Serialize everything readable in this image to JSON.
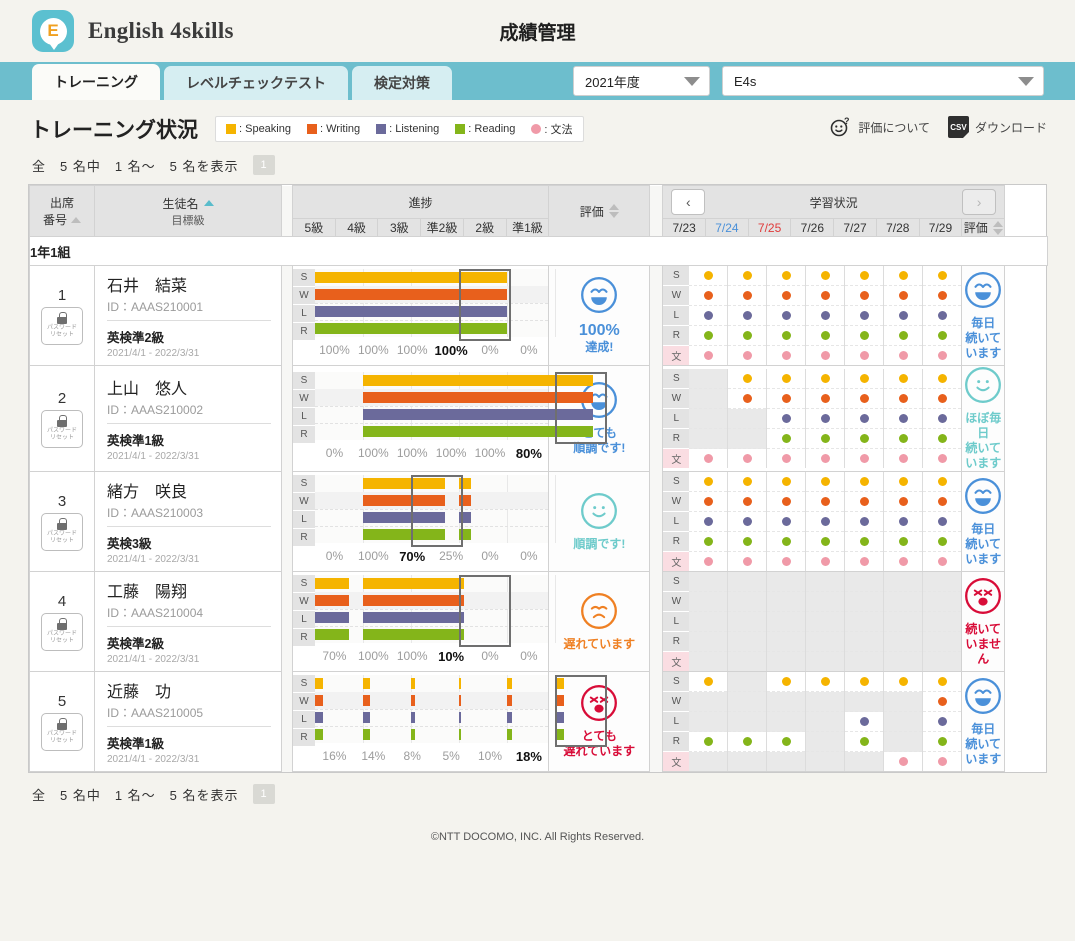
{
  "header": {
    "brand": "English 4skills",
    "logo_letter": "E",
    "page_title": "成績管理"
  },
  "tabs": [
    {
      "label": "トレーニング",
      "active": true
    },
    {
      "label": "レベルチェックテスト",
      "active": false
    },
    {
      "label": "検定対策",
      "active": false
    }
  ],
  "selects": {
    "year": "2021年度",
    "school": "E4s"
  },
  "section": {
    "title": "トレーニング状況",
    "legend": [
      {
        "label": ": Speaking",
        "color": "#f5b400",
        "shape": "square"
      },
      {
        "label": ": Writing",
        "color": "#e8601c",
        "shape": "square"
      },
      {
        "label": ": Listening",
        "color": "#6b6a9b",
        "shape": "square"
      },
      {
        "label": ": Reading",
        "color": "#84b51a",
        "shape": "square"
      },
      {
        "label": ": 文法",
        "color": "#f09aa8",
        "shape": "circle"
      }
    ],
    "about_eval": "評価について",
    "download": "ダウンロード",
    "csv_label": "CSV"
  },
  "counter": {
    "text": "全　5 名中　1 名〜　5 名を表示",
    "page": "1"
  },
  "table": {
    "col_attendance": "出席",
    "col_attendance2": "番号",
    "col_name": "生徒名",
    "col_name_sub": "目標級",
    "col_progress": "進捗",
    "grades": [
      "5級",
      "4級",
      "3級",
      "準2級",
      "2級",
      "準1級"
    ],
    "col_eval": "評価",
    "col_study": "学習状況",
    "days": [
      {
        "label": "7/23",
        "kind": "weekday"
      },
      {
        "label": "7/24",
        "kind": "sat"
      },
      {
        "label": "7/25",
        "kind": "sun"
      },
      {
        "label": "7/26",
        "kind": "weekday"
      },
      {
        "label": "7/27",
        "kind": "weekday"
      },
      {
        "label": "7/28",
        "kind": "weekday"
      },
      {
        "label": "7/29",
        "kind": "weekday"
      }
    ],
    "col_eval2": "評価",
    "nav_prev": "‹",
    "nav_next": "›",
    "class_group": "1年1組",
    "skill_labels": [
      "S",
      "W",
      "L",
      "R"
    ],
    "dot_labels": [
      "S",
      "W",
      "L",
      "R",
      "文"
    ],
    "pw_reset_line1": "パスワード",
    "pw_reset_line2": "リセット"
  },
  "skill_colors": {
    "S": "#f5b400",
    "W": "#e8601c",
    "L": "#6b6a9b",
    "R": "#84b51a",
    "文": "#f09aa8"
  },
  "students": [
    {
      "number": "1",
      "name": "石井　結菜",
      "id": "ID：AAAS210001",
      "goal": "英検準2級",
      "period": "2021/4/1 - 2022/3/31",
      "progress_percent_labels": [
        "100%",
        "100%",
        "100%",
        "100%",
        "0%",
        "0%"
      ],
      "progress_values": [
        100,
        100,
        100,
        100,
        0,
        0
      ],
      "current_grade_index": 3,
      "eval_face": "laugh",
      "eval_color": "#4a90d9",
      "eval_big": "100%",
      "eval_text": "達成!",
      "dots": [
        [
          "S",
          "W",
          "L",
          "R",
          "文"
        ],
        [
          "S",
          "W",
          "L",
          "R",
          "文"
        ],
        [
          "S",
          "W",
          "L",
          "R",
          "文"
        ],
        [
          "S",
          "W",
          "L",
          "R",
          "文"
        ],
        [
          "S",
          "W",
          "L",
          "R",
          "文"
        ],
        [
          "S",
          "W",
          "L",
          "R",
          "文"
        ],
        [
          "S",
          "W",
          "L",
          "R",
          "文"
        ]
      ],
      "study_face": "laugh",
      "study_color": "#4a90d9",
      "study_text_1": "毎日",
      "study_text_2": "続いています"
    },
    {
      "number": "2",
      "name": "上山　悠人",
      "id": "ID：AAAS210002",
      "goal": "英検準1級",
      "period": "2021/4/1 - 2022/3/31",
      "progress_percent_labels": [
        "0%",
        "100%",
        "100%",
        "100%",
        "100%",
        "80%"
      ],
      "progress_values": [
        0,
        100,
        100,
        100,
        100,
        80
      ],
      "current_grade_index": 5,
      "eval_face": "laugh",
      "eval_color": "#4a90d9",
      "eval_big": "",
      "eval_text": "とても\n順調です!",
      "dots": [
        [
          "文"
        ],
        [
          "S",
          "W",
          "文"
        ],
        [
          "S",
          "W",
          "L",
          "R",
          "文"
        ],
        [
          "S",
          "W",
          "L",
          "R",
          "文"
        ],
        [
          "S",
          "W",
          "L",
          "R",
          "文"
        ],
        [
          "S",
          "W",
          "L",
          "R",
          "文"
        ],
        [
          "S",
          "W",
          "L",
          "R",
          "文"
        ]
      ],
      "study_face": "smile",
      "study_color": "#6ecbcb",
      "study_text_1": "ほぼ毎日",
      "study_text_2": "続いています"
    },
    {
      "number": "3",
      "name": "緒方　咲良",
      "id": "ID：AAAS210003",
      "goal": "英検3級",
      "period": "2021/4/1 - 2022/3/31",
      "progress_percent_labels": [
        "0%",
        "100%",
        "70%",
        "25%",
        "0%",
        "0%"
      ],
      "progress_values": [
        0,
        100,
        70,
        25,
        0,
        0
      ],
      "current_grade_index": 2,
      "eval_face": "smile",
      "eval_color": "#6ecbcb",
      "eval_big": "",
      "eval_text": "順調です!",
      "dots": [
        [
          "S",
          "W",
          "L",
          "R",
          "文"
        ],
        [
          "S",
          "W",
          "L",
          "R",
          "文"
        ],
        [
          "S",
          "W",
          "L",
          "R",
          "文"
        ],
        [
          "S",
          "W",
          "L",
          "R",
          "文"
        ],
        [
          "S",
          "W",
          "L",
          "R",
          "文"
        ],
        [
          "S",
          "W",
          "L",
          "R",
          "文"
        ],
        [
          "S",
          "W",
          "L",
          "R",
          "文"
        ]
      ],
      "study_face": "laugh",
      "study_color": "#4a90d9",
      "study_text_1": "毎日",
      "study_text_2": "続いています"
    },
    {
      "number": "4",
      "name": "工藤　陽翔",
      "id": "ID：AAAS210004",
      "goal": "英検準2級",
      "period": "2021/4/1 - 2022/3/31",
      "progress_percent_labels": [
        "70%",
        "100%",
        "100%",
        "10%",
        "0%",
        "0%"
      ],
      "progress_values": [
        70,
        100,
        100,
        10,
        0,
        0
      ],
      "current_grade_index": 3,
      "eval_face": "sad",
      "eval_color": "#ef8023",
      "eval_big": "",
      "eval_text": "遅れています",
      "dots": [
        [],
        [],
        [],
        [],
        [],
        [],
        []
      ],
      "study_face": "cry",
      "study_color": "#d80c38",
      "study_text_1": "",
      "study_text_2": "続いていません"
    },
    {
      "number": "5",
      "name": "近藤　功",
      "id": "ID：AAAS210005",
      "goal": "英検準1級",
      "period": "2021/4/1 - 2022/3/31",
      "progress_percent_labels": [
        "16%",
        "14%",
        "8%",
        "5%",
        "10%",
        "18%"
      ],
      "progress_values": [
        16,
        14,
        8,
        5,
        10,
        18
      ],
      "current_grade_index": 5,
      "eval_face": "cry",
      "eval_color": "#d80c38",
      "eval_big": "",
      "eval_text": "とても\n遅れています",
      "dots": [
        [
          "S",
          "R"
        ],
        [
          "R"
        ],
        [
          "S",
          "R"
        ],
        [
          "S"
        ],
        [
          "S",
          "L",
          "R"
        ],
        [
          "S",
          "文"
        ],
        [
          "S",
          "W",
          "L",
          "R",
          "文"
        ]
      ],
      "study_face": "laugh",
      "study_color": "#4a90d9",
      "study_text_1": "毎日",
      "study_text_2": "続いています"
    }
  ],
  "chart_data": {
    "type": "bar",
    "title": "トレーニング状況 進捗",
    "categories": [
      "5級",
      "4級",
      "3級",
      "準2級",
      "2級",
      "準1級"
    ],
    "skills": [
      "Speaking",
      "Writing",
      "Listening",
      "Reading"
    ],
    "ylim": [
      0,
      100
    ],
    "unit": "%",
    "series": [
      {
        "name": "石井　結菜",
        "values": [
          100,
          100,
          100,
          100,
          0,
          0
        ],
        "highlight": "準2級"
      },
      {
        "name": "上山　悠人",
        "values": [
          0,
          100,
          100,
          100,
          100,
          80
        ],
        "highlight": "準1級"
      },
      {
        "name": "緒方　咲良",
        "values": [
          0,
          100,
          70,
          25,
          0,
          0
        ],
        "highlight": "3級"
      },
      {
        "name": "工藤　陽翔",
        "values": [
          70,
          100,
          100,
          10,
          0,
          0
        ],
        "highlight": "準2級"
      },
      {
        "name": "近藤　功",
        "values": [
          16,
          14,
          8,
          5,
          10,
          18
        ],
        "highlight": "準1級"
      }
    ]
  },
  "footer": "©NTT DOCOMO, INC. All Rights Reserved."
}
